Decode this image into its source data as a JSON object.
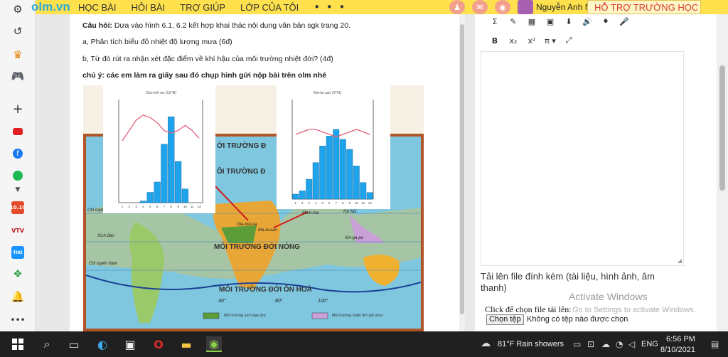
{
  "topnav": {
    "logo": "olm.vn",
    "items": [
      "HỌC BÀI",
      "HỎI BÀI",
      "TRỢ GIÚP",
      "LỚP CỦA TÔI"
    ],
    "more": "• • •",
    "user_name": "Nguyễn Anh Ngọc ▾",
    "support": "HỖ TRỢ TRƯỜNG HỌC"
  },
  "sidebar": {
    "icons": [
      "gear-icon",
      "history-icon",
      "crown-icon",
      "gamepad-icon",
      "plus-icon",
      "youtube-icon",
      "facebook-icon",
      "spotify-icon",
      "chevron-down-icon",
      "calendar-icon",
      "vtv-icon",
      "tiki-icon",
      "shapes-icon",
      "bell-icon",
      "more-icon"
    ],
    "calendar_badge": "10.10",
    "vtv_label": "VTV",
    "tiki_label": "TIKI"
  },
  "question": {
    "label": "Câu hỏi:",
    "text": " Dựa vào hình 6.1, 6.2 kết hợp khai thác nội dung văn bản sgk trang 20.",
    "part_a": "a, Phân tích biểu đồ nhiệt độ lượng mưa (6đ)",
    "part_b": "b, Từ đó rút ra nhận xét đặc điểm về khí hậu của môi trường nhiệt đới? (4đ)",
    "note": "chú ý: các em làm ra giấy sau đó chụp hình gửi nộp bài trên olm nhé"
  },
  "figure": {
    "chart1_title": "Gia-mê-na (12°B)",
    "chart2_title": "Ma-la-can (9°N)",
    "map_labels": {
      "zone1a": "ỚI TRƯỜNG Đ",
      "zone1b": "ÔI TRƯỜNG Đ",
      "hot_zone": "MÔI TRƯỜNG ĐỚI NÓNG",
      "temperate_zone": "MÔI TRƯỜNG ĐỚI ÔN HOÀ",
      "chi_tuyen_bac": "Chí tuyến Bắc",
      "xich_dao": "Xích đạo",
      "chi_tuyen_nam": "Chí tuyến Nam",
      "gia_me_na": "Gia-mê-na",
      "ma_la_can": "Ma-la-can",
      "mum_bai": "Mum-bai",
      "ha_noi": "Hà Nội",
      "xingapo": "Xin-ga-po",
      "lon_40": "40°",
      "lon_80": "80°",
      "lon_100": "100°",
      "legend1": "Môi trường xích đạo ẩm",
      "legend2": "Môi trường nhiệt đới gió mùa"
    }
  },
  "chart_data": [
    {
      "type": "bar",
      "title": "Gia-mê-na (12°B)",
      "categories": [
        "1",
        "2",
        "3",
        "4",
        "5",
        "6",
        "7",
        "8",
        "9",
        "10",
        "11",
        "12"
      ],
      "series": [
        {
          "values": [
            0,
            0,
            0,
            5,
            30,
            60,
            170,
            250,
            120,
            40,
            0,
            0
          ]
        },
        {
          "values": [
            24,
            28,
            32,
            34,
            33,
            31,
            28,
            27,
            28,
            30,
            28,
            25
          ]
        }
      ],
      "ylim_left": [
        0,
        300
      ],
      "ylim_right": [
        0,
        40
      ]
    },
    {
      "type": "bar",
      "title": "Ma-la-can (9°N)",
      "categories": [
        "1",
        "2",
        "3",
        "4",
        "5",
        "6",
        "7",
        "8",
        "9",
        "10",
        "11",
        "12"
      ],
      "series": [
        {
          "values": [
            15,
            25,
            60,
            110,
            160,
            190,
            210,
            180,
            150,
            100,
            50,
            20
          ]
        },
        {
          "values": [
            26,
            27,
            28,
            28,
            27,
            26,
            25,
            26,
            27,
            28,
            27,
            26
          ]
        }
      ],
      "ylim_left": [
        0,
        300
      ],
      "ylim_right": [
        0,
        40
      ]
    }
  ],
  "editor": {
    "toolbar_row1": [
      "Σ",
      "✎",
      "▦",
      "▣",
      "⬇",
      "🔊",
      "⏺",
      "🎤"
    ],
    "toolbar_row2": [
      "B",
      "x₂",
      "x²",
      "π ▾",
      "⤢"
    ],
    "upload_label": "Tải lên file đính kèm (tài liệu, hình ảnh, âm thanh)",
    "file_label": "Click để chọn file tải lên:",
    "file_button": "Chọn tệp",
    "file_status": "Không có tệp nào được chọn"
  },
  "watermark": {
    "line1": "Activate Windows",
    "line2": "Go to Settings to activate Windows."
  },
  "taskbar": {
    "weather": "81°F  Rain showers",
    "language": "ENG",
    "time": "6:56 PM",
    "date": "8/10/2021"
  }
}
